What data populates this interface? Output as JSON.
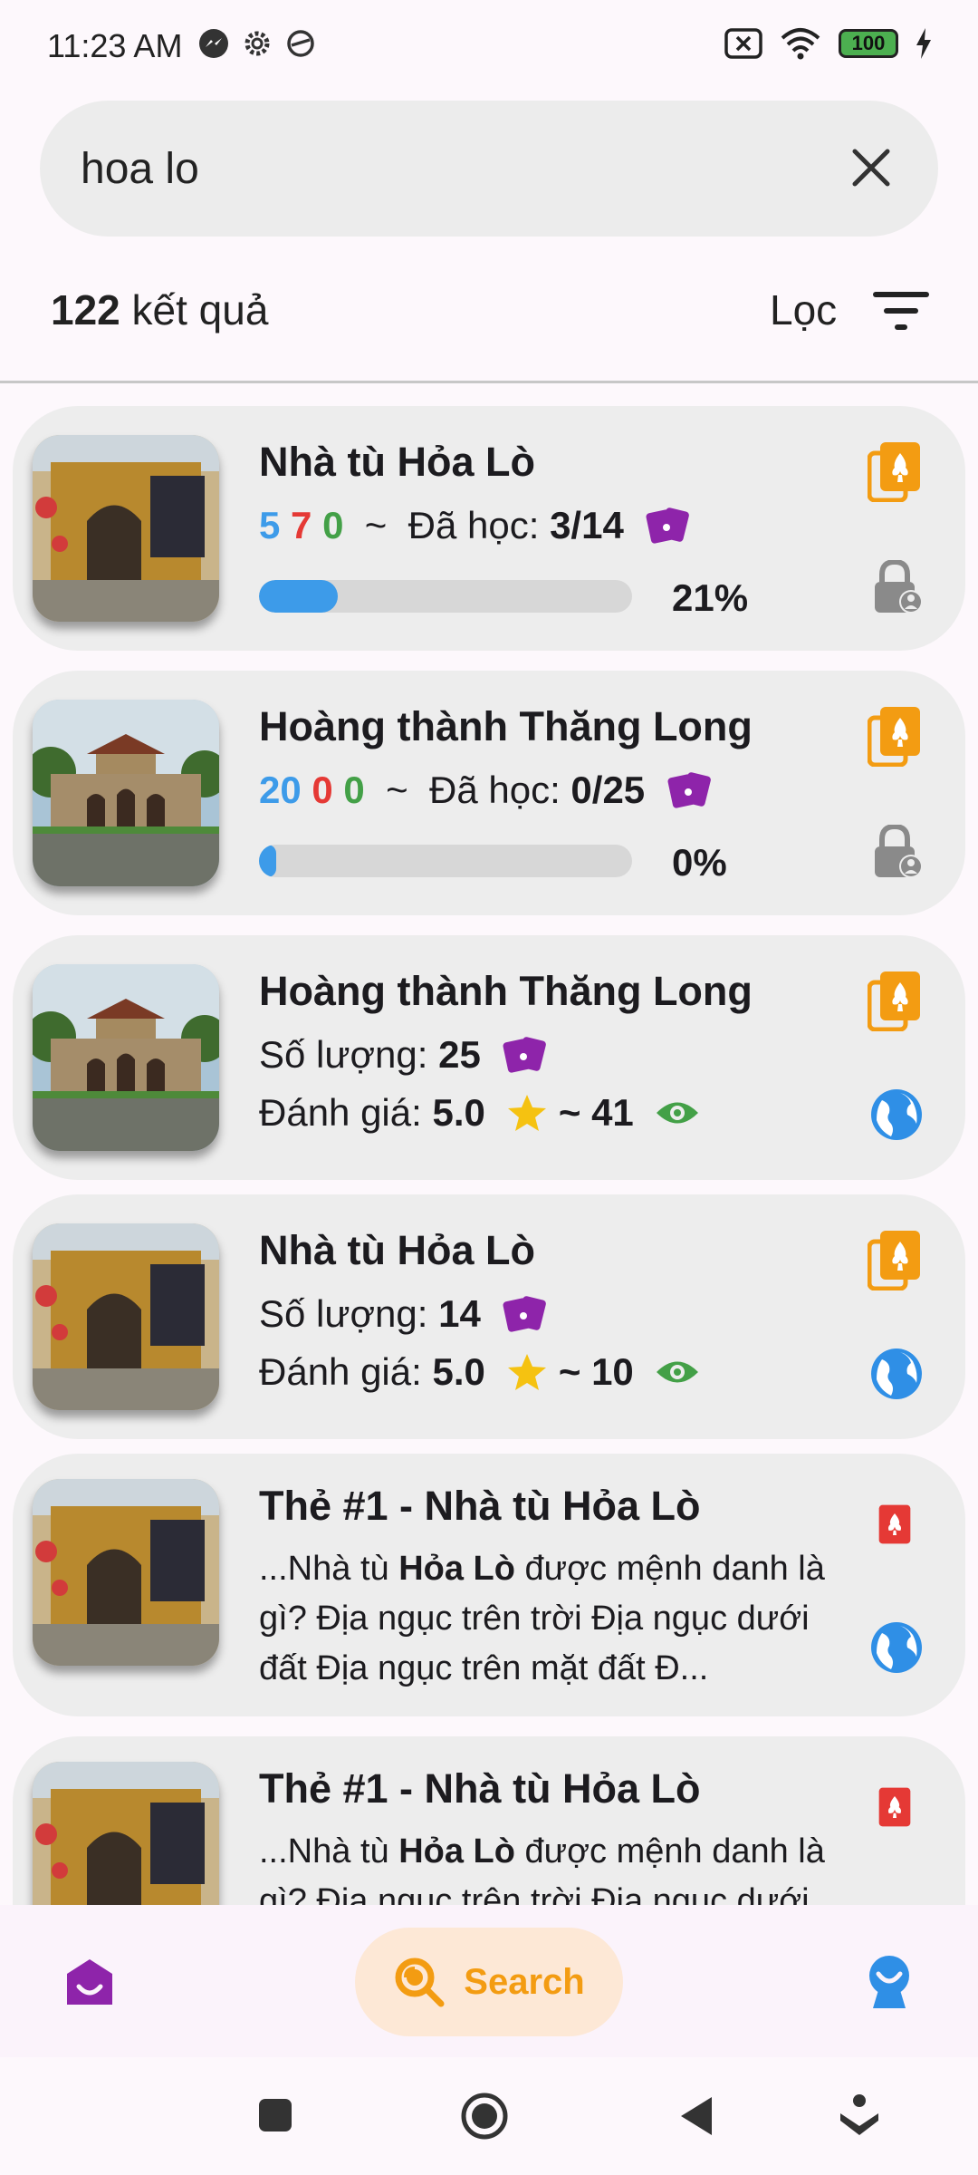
{
  "status_bar": {
    "time": "11:23 AM",
    "battery": "100"
  },
  "search": {
    "query": "hoa lo"
  },
  "results": {
    "count": "122",
    "count_suffix": "kết quả",
    "filter_label": "Lọc"
  },
  "cards": [
    {
      "title": "Nhà tù Hỏa Lò",
      "stats": [
        "5",
        "7",
        "0"
      ],
      "tilde": "~",
      "learned_label": "Đã học:",
      "learned_value": "3/14",
      "progress": 0.21,
      "progress_label": "21%"
    },
    {
      "title": "Hoàng thành Thăng Long",
      "stats": [
        "20",
        "0",
        "0"
      ],
      "tilde": "~",
      "learned_label": "Đã học:",
      "learned_value": "0/25",
      "progress": 0.0,
      "progress_label": "0%"
    },
    {
      "title": "Hoàng thành Thăng Long",
      "qty_label": "Số lượng:",
      "qty_value": "25",
      "rating_label": "Đánh giá:",
      "rating_value": "5.0",
      "views": "~ 41"
    },
    {
      "title": "Nhà tù Hỏa Lò",
      "qty_label": "Số lượng:",
      "qty_value": "14",
      "rating_label": "Đánh giá:",
      "rating_value": "5.0",
      "views": "~ 10"
    },
    {
      "title": "Thẻ #1 - Nhà tù Hỏa Lò",
      "snippet_pre": "...Nhà tù ",
      "snippet_bold": "Hỏa Lò",
      "snippet_post": " được mệnh danh là gì? Địa ngục trên trời Địa ngục dưới đất Địa ngục trên mặt đất Đ..."
    },
    {
      "title": "Thẻ #1 - Nhà tù Hỏa Lò",
      "snippet_pre": "...Nhà tù ",
      "snippet_bold": "Hỏa Lò",
      "snippet_post": " được mệnh danh là gì? Địa ngục trên trời Địa ngục dưới đất"
    }
  ],
  "bottom_nav": {
    "search_label": "Search"
  },
  "colors": {
    "accent_orange": "#f39c12",
    "blue": "#3d9be9",
    "red": "#e53935",
    "green": "#43a047",
    "purple": "#8e24aa"
  },
  "icons": [
    "messenger-icon",
    "gear-icon",
    "sync-icon",
    "sim-off-icon",
    "wifi-icon",
    "battery-icon",
    "charging-icon",
    "close-icon",
    "filter-icon",
    "deck-icon",
    "cards-icon",
    "lock-user-icon",
    "globe-icon",
    "star-icon",
    "eye-icon",
    "card-icon",
    "home-icon",
    "search-icon",
    "profile-icon"
  ]
}
